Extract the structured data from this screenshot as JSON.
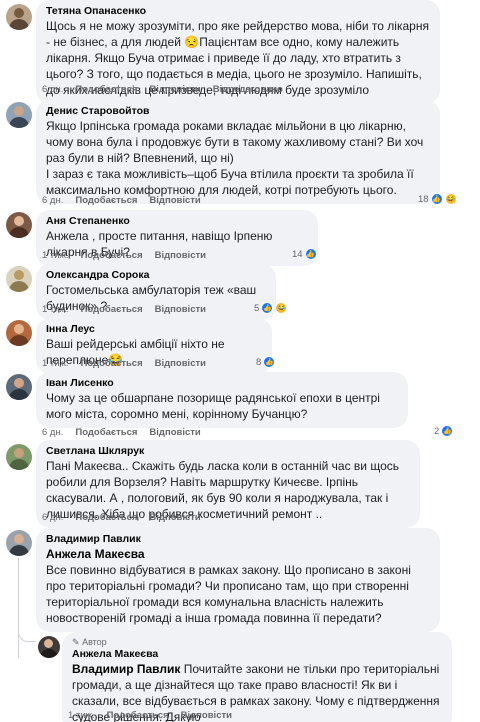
{
  "colors": {
    "bubble": "#f0f2f5",
    "meta": "#65676b",
    "like": "#1877f2",
    "haha": "#f7b928"
  },
  "labels": {
    "like": "Подобається",
    "reply": "Відповісти",
    "edited": "Відредаговано"
  },
  "comments": [
    {
      "author": "Тетяна Опанасенко",
      "text": "Щось я не можу зрозуміти, про яке рейдерство мова, ніби то лікарня - не бізнес, а для людей 😒Пацієнтам все одно, кому належить лікарня. Якщо Буча отримає і приведе її до ладу, хто втратить з цього? З того, що подається в медіа, цього не зрозуміло. Напишіть, до яких наслідків це призведе, тоді людям буде зрозуміло",
      "time": "6 дн.",
      "reactions": ""
    },
    {
      "author": "Денис Старовойтов",
      "text": "Якщо Ірпінська громада роками вкладає мільйони в цю лікарню, чому вона була і продовжує бути в такому жахливому стані? Ви хоч раз були в ній? Впевнений, що ні)\nІ зараз є така можливість–щоб Буча втілила проєкти та зробила її максимально комфортною для людей, котрі потребують цього.",
      "time": "6 дн.",
      "reactions": "18"
    },
    {
      "author": "Аня Степаненко",
      "text": "Анжела , просте питання, навіщо Ірпеню лікарня в Бучі?",
      "time": "1 тиж.",
      "reactions": "14"
    },
    {
      "author": "Олександра Сорока",
      "text": "Гостомельська амбулаторія теж «ваш будинок» ?",
      "time": "1 тиж.",
      "reactions": "5"
    },
    {
      "author": "Інна Леус",
      "text": "Ваші рейдерські амбіції ніхто не переплюне😂",
      "time": "1 тиж.",
      "reactions": "8"
    },
    {
      "author": "Іван Лисенко",
      "text": "Чому за це обшарпане позорище радянської епохи в центрі мого міста, соромно мені, корінному Бучанцю?",
      "time": "6 дн.",
      "reactions": "2"
    },
    {
      "author": "Светлана Шклярук",
      "text": "Пані Макеєва.. Скажіть будь ласка коли в останній час ви щось робили для Ворзеля? Навіть маршрутку Кичеєве. Ірпінь скасували. А , пологовий, як був 90 коли я народжувала, так і лишився. Хіба що робився косметичний ремонт ..",
      "time": "6 дн.",
      "reactions": ""
    },
    {
      "author": "Владимир Павлик",
      "mention": "Анжела Макеєва",
      "text": "Все повинно відбуватися в рамках закону. Що прописано в законі про територіальні громади? Чи прописано там, що при створенні територіальної громади вся комунальна власність належить новоствореній громаді а інша громада повинна її передати?",
      "time": "",
      "reactions": ""
    }
  ],
  "reply": {
    "badge": "Автор",
    "author": "Анжела Макеєва",
    "mention": "Владимир Павлик",
    "text": " Почитайте закони не тільки про територіальні громади, а ще дізнайтеся що таке право власності! Як ви і сказали, все відбувається в рамках закону. Чому є підтвердження судове рішення. Дякую",
    "time": "1 тиж."
  }
}
